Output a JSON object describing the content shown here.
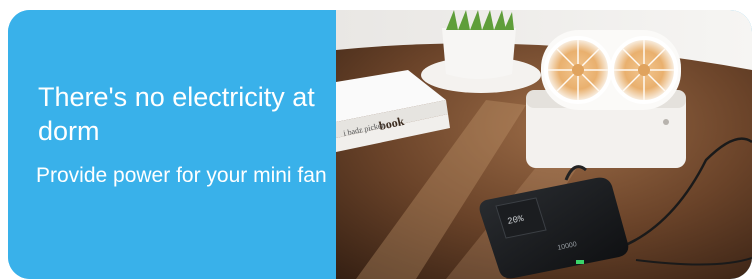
{
  "banner": {
    "headline": "There's no electricity at dorm",
    "subline": "Provide power for your mini fan",
    "accent_color": "#39b1ea"
  },
  "photo": {
    "book_spine_text": "book",
    "book_cover_text": "i badz picken",
    "power_bank_display": "20%",
    "power_bank_label": "10000"
  }
}
